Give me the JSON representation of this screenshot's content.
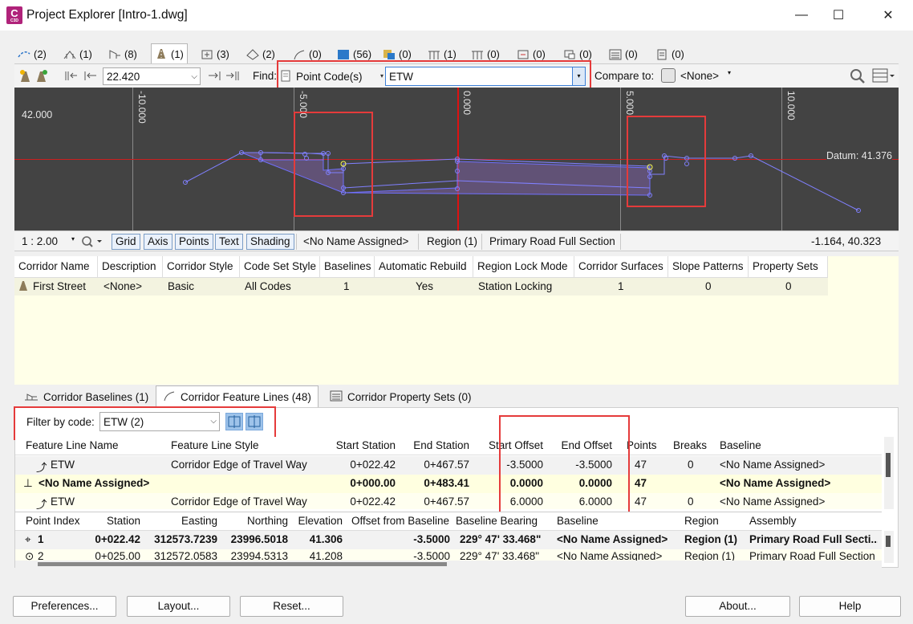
{
  "window": {
    "title": "Project Explorer [Intro-1.dwg]"
  },
  "object_tabs": [
    {
      "icon": "alignment-icon",
      "count": "(2)"
    },
    {
      "icon": "profile-icon",
      "count": "(1)"
    },
    {
      "icon": "assembly-icon",
      "count": "(8)"
    },
    {
      "icon": "corridor-icon",
      "count": "(1)"
    },
    {
      "icon": "sample-lines-icon",
      "count": "(3)"
    },
    {
      "icon": "surface-icon",
      "count": "(2)"
    },
    {
      "icon": "feature-line-icon",
      "count": "(0)"
    },
    {
      "icon": "points-icon",
      "count": "(56)"
    },
    {
      "icon": "point-group-icon",
      "count": "(0)"
    },
    {
      "icon": "parcel-icon",
      "count": "(1)"
    },
    {
      "icon": "pipe-network-icon",
      "count": "(0)"
    },
    {
      "icon": "pressure-network-icon",
      "count": "(0)"
    },
    {
      "icon": "view-frame-icon",
      "count": "(0)"
    },
    {
      "icon": "sheet-icon",
      "count": "(0)"
    },
    {
      "icon": "data-shortcut-icon",
      "count": "(0)"
    }
  ],
  "toolbar": {
    "station_value": "22.420",
    "find_label": "Find:",
    "find_type": "Point Code(s)",
    "find_value": "ETW",
    "compare_label": "Compare to:",
    "compare_value": "<None>"
  },
  "viewport": {
    "offset_labels": [
      "-10.000",
      "-5.000",
      "0.000",
      "5.000",
      "10.000"
    ],
    "elevation_label": "42.000",
    "datum_label": "Datum: 41.376"
  },
  "status": {
    "scale": "1 : 2.00",
    "toggles": [
      "Grid",
      "Axis",
      "Points",
      "Text",
      "Shading"
    ],
    "baseline": "<No Name Assigned>",
    "region": "Region (1)",
    "assembly": "Primary Road Full Section",
    "coords": "-1.164, 40.323"
  },
  "corridor_table": {
    "headers": [
      "Corridor Name",
      "Description",
      "Corridor Style",
      "Code Set Style",
      "Baselines",
      "Automatic Rebuild",
      "Region Lock Mode",
      "Corridor Surfaces",
      "Slope Patterns",
      "Property Sets"
    ],
    "row": [
      "First Street",
      "<None>",
      "Basic",
      "All Codes",
      "1",
      "Yes",
      "Station Locking",
      "1",
      "0",
      "0"
    ]
  },
  "bottom_tabs": [
    {
      "label": "Corridor Baselines (1)"
    },
    {
      "label": "Corridor Feature Lines (48)"
    },
    {
      "label": "Corridor Property Sets (0)"
    }
  ],
  "filter": {
    "label": "Filter by code:",
    "value": "ETW  (2)"
  },
  "feature_table": {
    "headers": [
      "Feature Line Name",
      "Feature Line Style",
      "Start Station",
      "End Station",
      "Start Offset",
      "End Offset",
      "Points",
      "Breaks",
      "Baseline"
    ],
    "rows": [
      [
        "ETW",
        "Corridor Edge of Travel Way",
        "0+022.42",
        "0+467.57",
        "-3.5000",
        "-3.5000",
        "47",
        "0",
        "<No Name Assigned>"
      ],
      [
        "<No Name Assigned>",
        "",
        "0+000.00",
        "0+483.41",
        "0.0000",
        "0.0000",
        "47",
        "",
        "<No Name Assigned>"
      ],
      [
        "ETW",
        "Corridor Edge of Travel Way",
        "0+022.42",
        "0+467.57",
        "6.0000",
        "6.0000",
        "47",
        "0",
        "<No Name Assigned>"
      ]
    ]
  },
  "point_table": {
    "headers": [
      "Point Index",
      "Station",
      "Easting",
      "Northing",
      "Elevation",
      "Offset from Baseline",
      "Baseline Bearing",
      "Baseline",
      "Region",
      "Assembly"
    ],
    "rows": [
      [
        "1",
        "0+022.42",
        "312573.7239",
        "23996.5018",
        "41.306",
        "-3.5000",
        "229° 47' 33.468\"",
        "<No Name Assigned>",
        "Region (1)",
        "Primary Road Full Secti..."
      ],
      [
        "2",
        "0+025.00",
        "312572.0583",
        "23994.5313",
        "41.208",
        "-3.5000",
        "229° 47' 33.468\"",
        "<No Name Assigned>",
        "Region (1)",
        "Primary Road Full Section"
      ]
    ]
  },
  "footer": {
    "preferences": "Preferences...",
    "layout": "Layout...",
    "reset": "Reset...",
    "about": "About...",
    "help": "Help"
  }
}
